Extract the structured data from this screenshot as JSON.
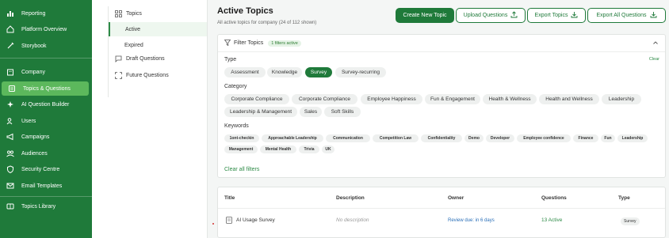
{
  "sidebar": {
    "items": [
      {
        "label": "Reporting",
        "icon": "bar-chart-icon",
        "active": false
      },
      {
        "label": "Platform Overview",
        "icon": "home-icon",
        "active": false
      },
      {
        "label": "Storybook",
        "icon": "pen-icon",
        "active": false
      },
      {
        "label": "Company",
        "icon": "building-icon",
        "active": false
      },
      {
        "label": "Topics & Questions",
        "icon": "book-icon",
        "active": true
      },
      {
        "label": "AI Question Builder",
        "icon": "sparkle-icon",
        "active": false
      },
      {
        "label": "Users",
        "icon": "users-icon",
        "active": false
      },
      {
        "label": "Campaigns",
        "icon": "megaphone-icon",
        "active": false
      },
      {
        "label": "Audiences",
        "icon": "audience-icon",
        "active": false
      },
      {
        "label": "Security Centre",
        "icon": "shield-icon",
        "active": false
      },
      {
        "label": "Email Templates",
        "icon": "mail-icon",
        "active": false
      },
      {
        "label": "Topics Library",
        "icon": "library-icon",
        "active": false
      }
    ]
  },
  "subnav": {
    "topics": "Topics",
    "active": "Active",
    "expired": "Expired",
    "draft_questions": "Draft Questions",
    "future_questions": "Future Questions"
  },
  "header": {
    "title": "Active Topics",
    "subtitle": "All active topics for company (24 of 112 shown)",
    "buttons": {
      "create": "Create New Topic",
      "upload": "Upload Questions",
      "export_topics": "Export Topics",
      "export_all": "Export All Questions"
    }
  },
  "filters": {
    "title": "Filter Topics",
    "badge": "1 filters active",
    "clear": "Clear",
    "clear_all": "Clear all filters",
    "type_label": "Type",
    "types": [
      "Assessment",
      "Knowledge",
      "Survey",
      "Survey-recurring"
    ],
    "selected_type": "Survey",
    "category_label": "Category",
    "categories": [
      "Corporate Compliance",
      "Corporate Compliance",
      "Employee Happiness",
      "Fun & Engagement",
      "Health & Wellness",
      "Health and Wellness",
      "Leadership",
      "Leadership & Management",
      "Sales",
      "Soft Skills"
    ],
    "keywords_label": "Keywords",
    "keywords": [
      "1ont-checkin",
      "Approachable Leadership",
      "Communication",
      "Competition Law",
      "Confidentiality",
      "Demo",
      "Developer",
      "Employee confidence",
      "Finance",
      "Fun",
      "Leadership",
      "Management",
      "Mental Health",
      "Trivia",
      "UK"
    ]
  },
  "table": {
    "columns": [
      "Title",
      "Description",
      "Owner",
      "Questions",
      "Type"
    ],
    "rows": [
      {
        "title": "AI Usage Survey",
        "description": "No description",
        "owner": "Review due: in 6 days",
        "questions": "13 Active",
        "type": "Survey"
      }
    ]
  },
  "colors": {
    "brand": "#1f7a3a",
    "accent": "#5cb85c"
  }
}
